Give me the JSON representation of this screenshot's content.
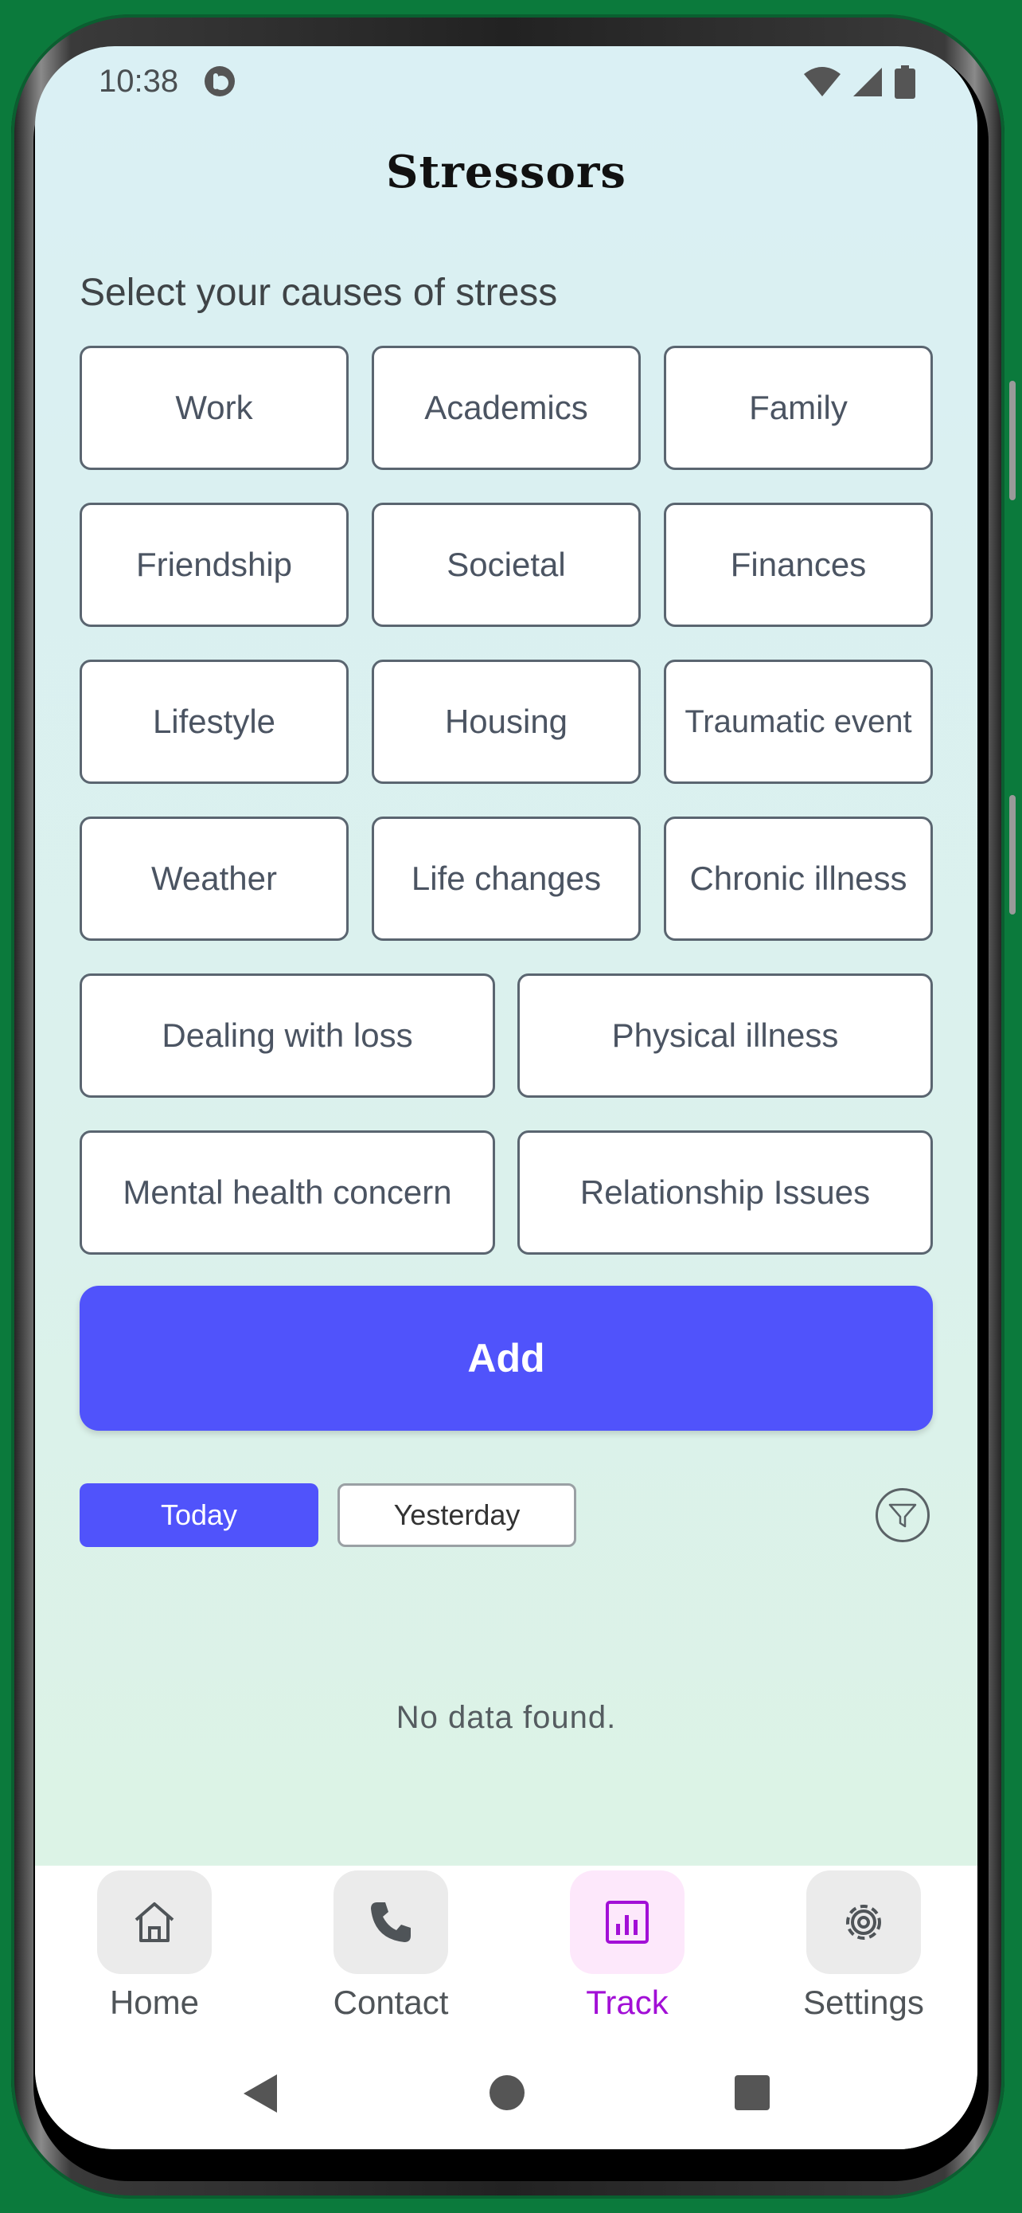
{
  "status_bar": {
    "time": "10:38"
  },
  "header": {
    "title": "Stressors"
  },
  "subtitle": "Select your causes of stress",
  "stressors": {
    "work": "Work",
    "academics": "Academics",
    "family": "Family",
    "friendship": "Friendship",
    "societal": "Societal",
    "finances": "Finances",
    "lifestyle": "Lifestyle",
    "housing": "Housing",
    "traumatic_event": "Traumatic event",
    "weather": "Weather",
    "life_changes": "Life changes",
    "chronic_illness": "Chronic illness",
    "dealing_with_loss": "Dealing with loss",
    "physical_illness": "Physical illness",
    "mental_health_concern": "Mental health concern",
    "relationship_issues": "Relationship Issues"
  },
  "add_label": "Add",
  "date_filter": {
    "today": "Today",
    "yesterday": "Yesterday",
    "selected": "Today"
  },
  "empty_message": "No data found.",
  "bottom_nav": {
    "items": [
      {
        "label": "Home",
        "icon": "home-icon"
      },
      {
        "label": "Contact",
        "icon": "phone-icon"
      },
      {
        "label": "Track",
        "icon": "chart-icon",
        "active": true
      },
      {
        "label": "Settings",
        "icon": "gear-icon"
      }
    ]
  },
  "colors": {
    "accent": "#5053fb",
    "active_nav": "#a20fd6",
    "frame": "#0b7a3c"
  }
}
